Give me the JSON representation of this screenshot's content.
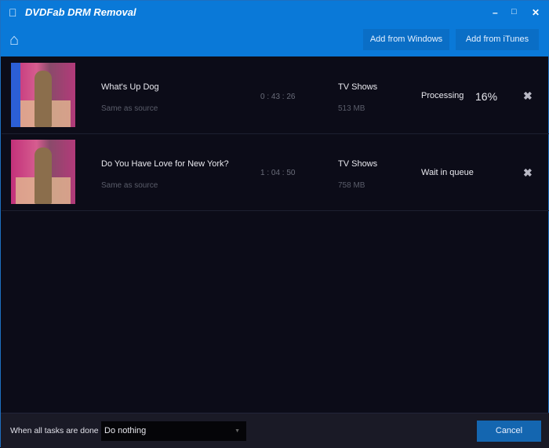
{
  "app": {
    "title": "DVDFab DRM Removal"
  },
  "window_controls": {
    "minimize": "–",
    "maximize": "□",
    "close": "✕"
  },
  "toolbar": {
    "add_windows": "Add from Windows",
    "add_itunes": "Add from iTunes"
  },
  "tasks": [
    {
      "title": "What's Up Dog",
      "profile": "Same as source",
      "duration": "0 : 43 : 26",
      "category": "TV Shows",
      "size": "513 MB",
      "status": "Processing",
      "progress": "16%"
    },
    {
      "title": "Do You Have Love for New York?",
      "profile": "Same as source",
      "duration": "1 : 04 : 50",
      "category": "TV Shows",
      "size": "758 MB",
      "status": "Wait in queue"
    }
  ],
  "footer": {
    "label": "When all tasks are done",
    "select_value": "Do nothing",
    "cancel": "Cancel"
  },
  "colors": {
    "accent": "#0a79d8",
    "background": "#0c0c18"
  }
}
